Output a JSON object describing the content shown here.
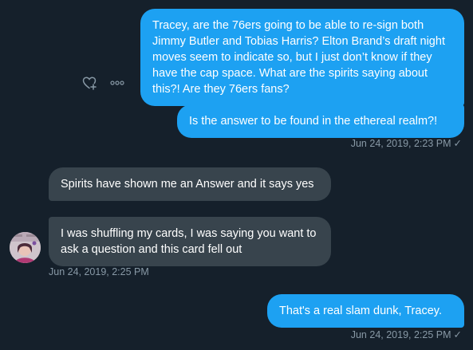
{
  "conversation": {
    "messages": [
      {
        "direction": "outgoing",
        "text": "Tracey, are the 76ers going to be able to re-sign both Jimmy Butler and Tobias Harris? Elton Brand’s draft night moves seem to indicate so, but I just don’t know if they have the cap space. What are the spirits saying about this?! Are they 76ers fans?"
      },
      {
        "direction": "outgoing",
        "text": "Is the answer to be found in the ethereal realm?!"
      },
      {
        "direction": "incoming",
        "text": "Spirits have shown me an Answer and it says yes"
      },
      {
        "direction": "incoming",
        "text": "I was shuffling my cards, I was saying you want to ask a question and this card fell out"
      },
      {
        "direction": "outgoing",
        "text": "That's a real slam dunk, Tracey."
      }
    ],
    "timestamps": {
      "group1": "Jun 24, 2019, 2:23 PM",
      "group2": "Jun 24, 2019, 2:25 PM",
      "group3": "Jun 24, 2019, 2:25 PM"
    },
    "read_mark": "✓"
  },
  "icons": {
    "react": "heart-plus-icon",
    "more": "more-icon"
  },
  "colors": {
    "background": "#15202b",
    "outgoing_bubble": "#1da1f2",
    "incoming_bubble": "#38444d",
    "timestamp": "#8899a6"
  }
}
